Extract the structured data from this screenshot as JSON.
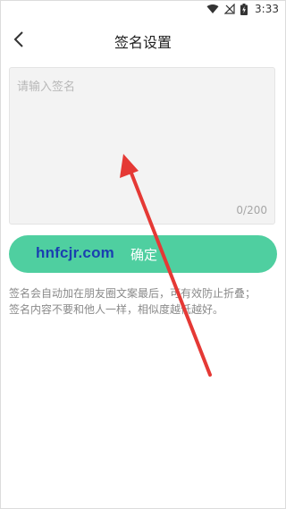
{
  "status_bar": {
    "time": "3:33",
    "icons": [
      "wifi-icon",
      "no-sim-signal-icon",
      "battery-charging-icon"
    ]
  },
  "header": {
    "title": "签名设置",
    "back_icon": "chevron-left-icon"
  },
  "signature": {
    "placeholder": "请输入签名",
    "value": "",
    "counter": "0/200"
  },
  "confirm_button": {
    "label": "确定",
    "color": "#4fcfa0"
  },
  "hint": {
    "line1": "签名会自动加在朋友圈文案最后，可有效防止折叠；",
    "line2": "签名内容不要和他人一样，相似度越低越好。"
  },
  "watermark": "hnfcjr.com",
  "annotation": {
    "type": "arrow",
    "color": "#e53935"
  }
}
